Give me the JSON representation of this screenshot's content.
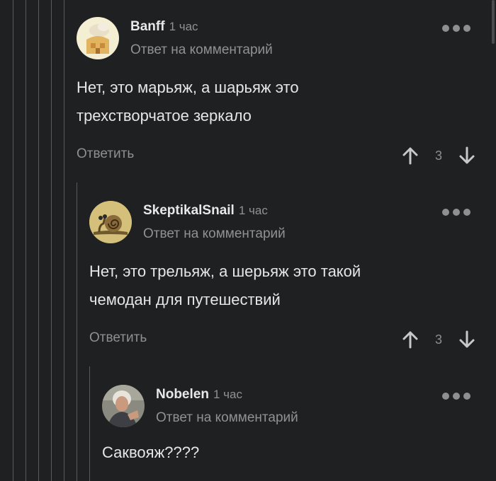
{
  "colors": {
    "background": "#1f2022",
    "thread_line": "#5a5b5e",
    "muted": "#8e8f92"
  },
  "comments": [
    {
      "author": "Banff",
      "time": "1 час",
      "reply_label": "Ответ на комментарий",
      "text_lines": [
        "Нет, это марьяж, а шарьяж это",
        "трехстворчатое зеркало"
      ],
      "reply_button": "Ответить",
      "rating": "3",
      "avatar_icon": "cartoon-house-avatar"
    },
    {
      "author": "SkeptikalSnail",
      "time": "1 час",
      "reply_label": "Ответ на комментарий",
      "text_lines": [
        "Нет, это трельяж, а шерьяж это такой",
        "чемодан для путешествий"
      ],
      "reply_button": "Ответить",
      "rating": "3",
      "avatar_icon": "snail-avatar"
    },
    {
      "author": "Nobelen",
      "time": "1 час",
      "reply_label": "Ответ на комментарий",
      "text_lines": [
        "Саквояж????"
      ],
      "avatar_icon": "woman-photo-avatar"
    }
  ],
  "icons": {
    "menu": "more-dots-icon",
    "upvote": "arrow-up-icon",
    "downvote": "arrow-down-icon"
  }
}
